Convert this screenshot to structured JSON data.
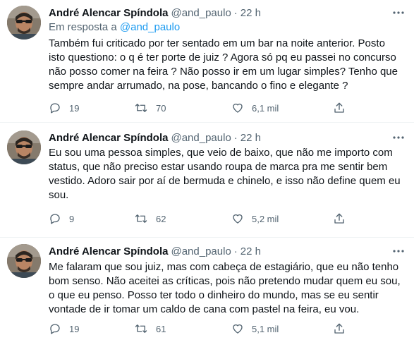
{
  "tweets": [
    {
      "author": "André Alencar Spíndola",
      "handle": "@and_paulo",
      "separator": "·",
      "time": "22 h",
      "reply_prefix": "Em resposta a",
      "reply_to": "@and_paulo",
      "lines": [
        "Também fui criticado por ter sentado em um bar na noite anterior. Posto",
        "isto questiono: o q é ter porte de juiz ? Agora só pq eu passei no concurso",
        "não posso comer na feira ? Não posso ir em um lugar simples? Tenho que",
        "sempre andar arrumado, na pose, bancando o fino e elegante ?"
      ],
      "replies": "19",
      "retweets": "70",
      "likes": "6,1 mil"
    },
    {
      "author": "André Alencar Spíndola",
      "handle": "@and_paulo",
      "separator": "·",
      "time": "22 h",
      "lines": [
        "Eu sou uma pessoa simples, que veio de baixo, que não me importo com",
        "status, que não preciso estar usando roupa de marca pra me sentir bem",
        "vestido. Adoro sair por aí de bermuda e chinelo, e isso não define quem eu",
        "sou."
      ],
      "replies": "9",
      "retweets": "62",
      "likes": "5,2 mil"
    },
    {
      "author": "André Alencar Spíndola",
      "handle": "@and_paulo",
      "separator": "·",
      "time": "22 h",
      "lines": [
        "Me falaram que sou juiz, mas com cabeça de estagiário, que eu não tenho",
        "bom senso. Não aceitei as críticas, pois não pretendo mudar quem eu sou,",
        "o que eu penso. Posso ter todo o dinheiro do mundo, mas se eu sentir",
        "vontade de ir tomar um caldo de cana com pastel na feira, eu vou."
      ],
      "replies": "19",
      "retweets": "61",
      "likes": "5,1 mil"
    }
  ],
  "icons": {
    "more": "more-horizontal-icon",
    "reply": "reply-bubble-icon",
    "retweet": "retweet-icon",
    "like": "heart-icon",
    "share": "share-icon"
  },
  "colors": {
    "text": "#0f1419",
    "secondary": "#536471",
    "link": "#1d9bf0",
    "divider": "#eff3f4"
  }
}
